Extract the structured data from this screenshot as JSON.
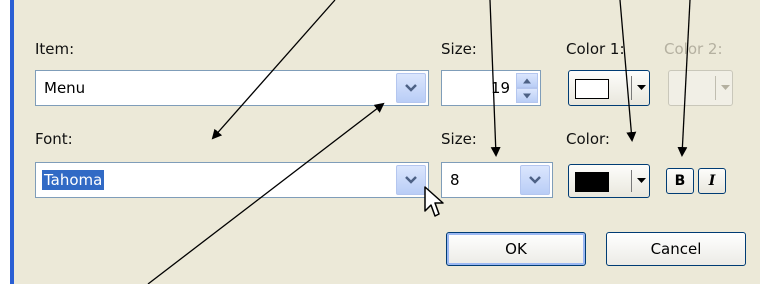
{
  "item_section": {
    "label": "Item:",
    "value": "Menu",
    "size_label": "Size:",
    "size_value": "19",
    "color1_label": "Color 1:",
    "color1_value": "#ffffff",
    "color2_label": "Color 2:"
  },
  "font_section": {
    "label": "Font:",
    "value": "Tahoma",
    "size_label": "Size:",
    "size_value": "8",
    "color_label": "Color:",
    "color_value": "#000000",
    "bold_label": "B",
    "italic_label": "I"
  },
  "buttons": {
    "ok_label": "OK",
    "cancel_label": "Cancel"
  },
  "icons": {
    "dropdown": "chevron-down-icon",
    "spinner_up": "arrow-up-icon",
    "spinner_down": "arrow-down-icon",
    "cursor": "mouse-pointer-icon"
  },
  "colors": {
    "selection": "#316ac5",
    "accent_border": "#2a5fd4",
    "dialog_bg": "#ece9d8"
  }
}
